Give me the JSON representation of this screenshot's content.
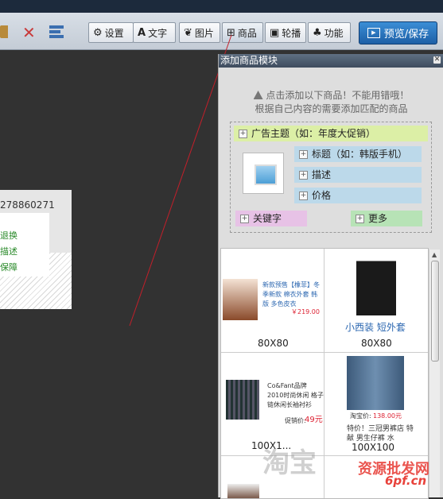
{
  "toolbar": {
    "settings": "设置",
    "text": "文字",
    "image": "图片",
    "product": "商品",
    "carousel": "轮播",
    "function": "功能",
    "preview": "预览/保存"
  },
  "canvas_card": {
    "number": "278860271",
    "lines": [
      "退换",
      "描述",
      "保障"
    ]
  },
  "panel": {
    "title": "添加商品模块",
    "notice_1": "点击添加以下商品！不能用错哦！",
    "notice_2": "根据自己内容的需要添加匹配的商品",
    "ad_theme": "广告主题（如：年度大促销）",
    "title_field": "标题（如：韩版手机）",
    "desc_field": "描述",
    "price_field": "价格",
    "keyword_field": "关键字",
    "more_field": "更多"
  },
  "products": [
    {
      "text": "新款预售【橡菲】冬季新款 棉衣外套 韩版 多色皮衣",
      "price": "￥219.00",
      "size": "80X80"
    },
    {
      "title": "小西装 短外套",
      "size": "80X80"
    },
    {
      "text": "Co&Fant品牌 2010时尚休闲 格子链休闲长袖衬衫",
      "price_label": "促销价:",
      "price": "49元",
      "size": "100X1..."
    },
    {
      "price_label": "淘宝价:",
      "price": "138.00元",
      "text": "特价！三冠男裤店 特献 男生仔裤 水",
      "size": "100X100"
    }
  ],
  "watermarks": {
    "main": "资源批发网",
    "site": "6pf.cn",
    "faded": "淘宝"
  },
  "colors": {
    "accent": "#1d5fa6",
    "ad_chip": "#dcefa6",
    "field_chip": "#bcd9ea",
    "keyword_chip": "#e7c2e6",
    "more_chip": "#b7e3b6",
    "link_blue": "#2a66b0",
    "price_red": "#d23"
  }
}
